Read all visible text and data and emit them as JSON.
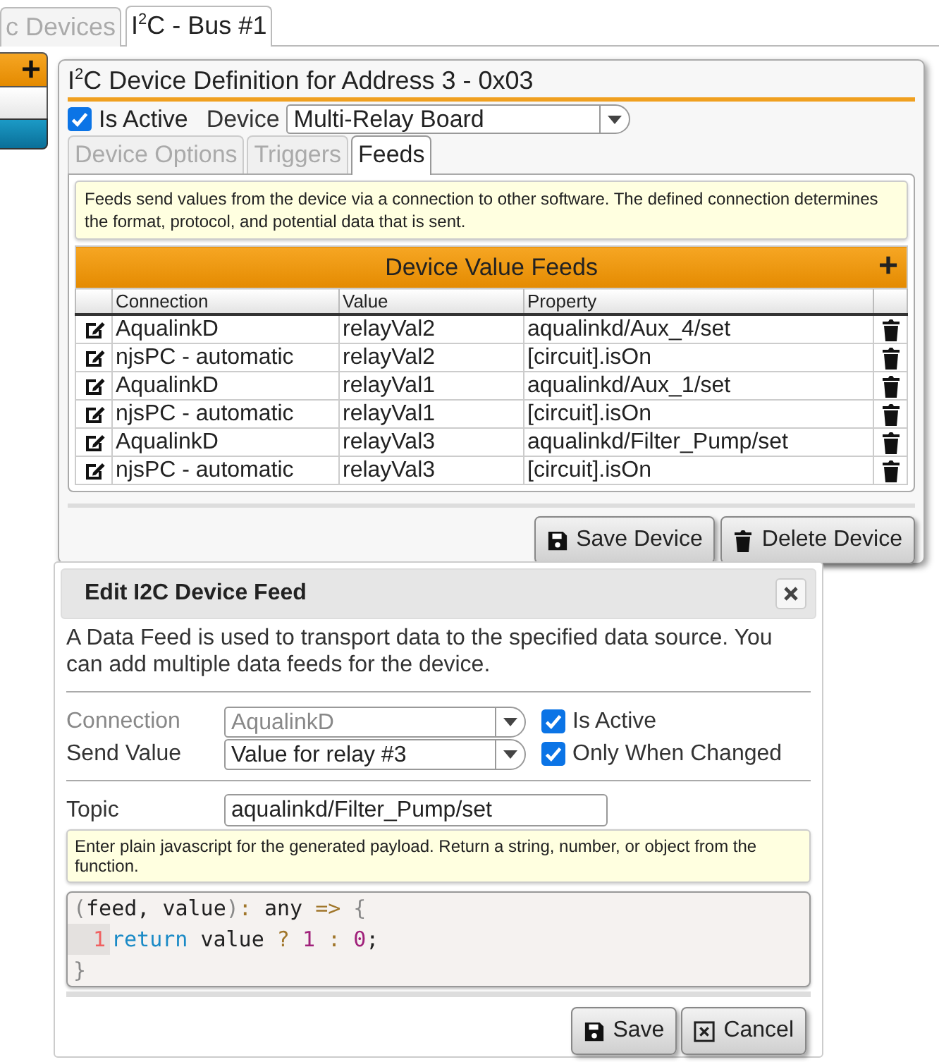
{
  "tabs": [
    {
      "label": "c Devices",
      "selected": false
    },
    {
      "label": "I$^{2}$C - Bus #1",
      "selected": true
    }
  ],
  "left_panel": {
    "add_label": "+"
  },
  "device_panel": {
    "title": "I$^{2}$C Device Definition for Address 3 - 0x03",
    "is_active": {
      "label": "Is Active",
      "checked": true
    },
    "device": {
      "label": "Device",
      "value": "Multi-Relay Board"
    },
    "tabs": [
      {
        "label": "Device Options",
        "selected": false
      },
      {
        "label": "Triggers",
        "selected": false
      },
      {
        "label": "Feeds",
        "selected": true
      }
    ],
    "info": "Feeds send values from the device via a connection to other software. The defined connection determines the format, protocol, and potential data that is sent.",
    "table": {
      "title": "Device Value Feeds",
      "add_label": "+",
      "columns": [
        "Connection",
        "Value",
        "Property"
      ],
      "rows": [
        {
          "connection": "AqualinkD",
          "value": "relayVal2",
          "property": "aqualinkd/Aux_4/set"
        },
        {
          "connection": "njsPC - automatic",
          "value": "relayVal2",
          "property": "[circuit].isOn"
        },
        {
          "connection": "AqualinkD",
          "value": "relayVal1",
          "property": "aqualinkd/Aux_1/set"
        },
        {
          "connection": "njsPC - automatic",
          "value": "relayVal1",
          "property": "[circuit].isOn"
        },
        {
          "connection": "AqualinkD",
          "value": "relayVal3",
          "property": "aqualinkd/Filter_Pump/set"
        },
        {
          "connection": "njsPC - automatic",
          "value": "relayVal3",
          "property": "[circuit].isOn"
        }
      ]
    },
    "buttons": [
      {
        "label": "Save Device",
        "kind": "save"
      },
      {
        "label": "Delete Device",
        "kind": "delete"
      }
    ]
  },
  "dialog": {
    "title": "Edit I2C Device Feed",
    "description": "A Data Feed is used to transport data to the specified data source. You can add multiple data feeds for the device.",
    "fields": [
      {
        "label": "Connection",
        "value": "AqualinkD",
        "disabled": true,
        "option": {
          "label": "Is Active",
          "checked": true
        }
      },
      {
        "label": "Send Value",
        "value": "Value for relay #3",
        "disabled": false,
        "option": {
          "label": "Only When Changed",
          "checked": true
        }
      }
    ],
    "topic": {
      "label": "Topic",
      "value": "aqualinkd/Filter_Pump/set"
    },
    "hint": "Enter plain javascript for the generated payload. Return a string, number, or object from the function.",
    "code": {
      "header": [
        {
          "text": "(",
          "kind": "bracket"
        },
        {
          "text": "feed, value",
          "kind": "plain"
        },
        {
          "text": ")",
          "kind": "bracket"
        },
        {
          "text": ": ",
          "kind": "operator"
        },
        {
          "text": "any ",
          "kind": "plain"
        },
        {
          "text": "=>",
          "kind": "operator"
        },
        {
          "text": " {",
          "kind": "bracket"
        }
      ],
      "lines": [
        {
          "number": "1",
          "tokens": [
            {
              "text": "return",
              "kind": "keyword"
            },
            {
              "text": " value ",
              "kind": "plain"
            },
            {
              "text": "?",
              "kind": "operator"
            },
            {
              "text": " 1",
              "kind": "number"
            },
            {
              "text": " :",
              "kind": "operator"
            },
            {
              "text": " 0",
              "kind": "number"
            },
            {
              "text": ";",
              "kind": "plain"
            }
          ]
        }
      ],
      "footer": [
        {
          "text": "}",
          "kind": "bracket"
        }
      ]
    },
    "buttons": [
      {
        "label": "Save",
        "kind": "save"
      },
      {
        "label": "Cancel",
        "kind": "cancel"
      }
    ]
  }
}
